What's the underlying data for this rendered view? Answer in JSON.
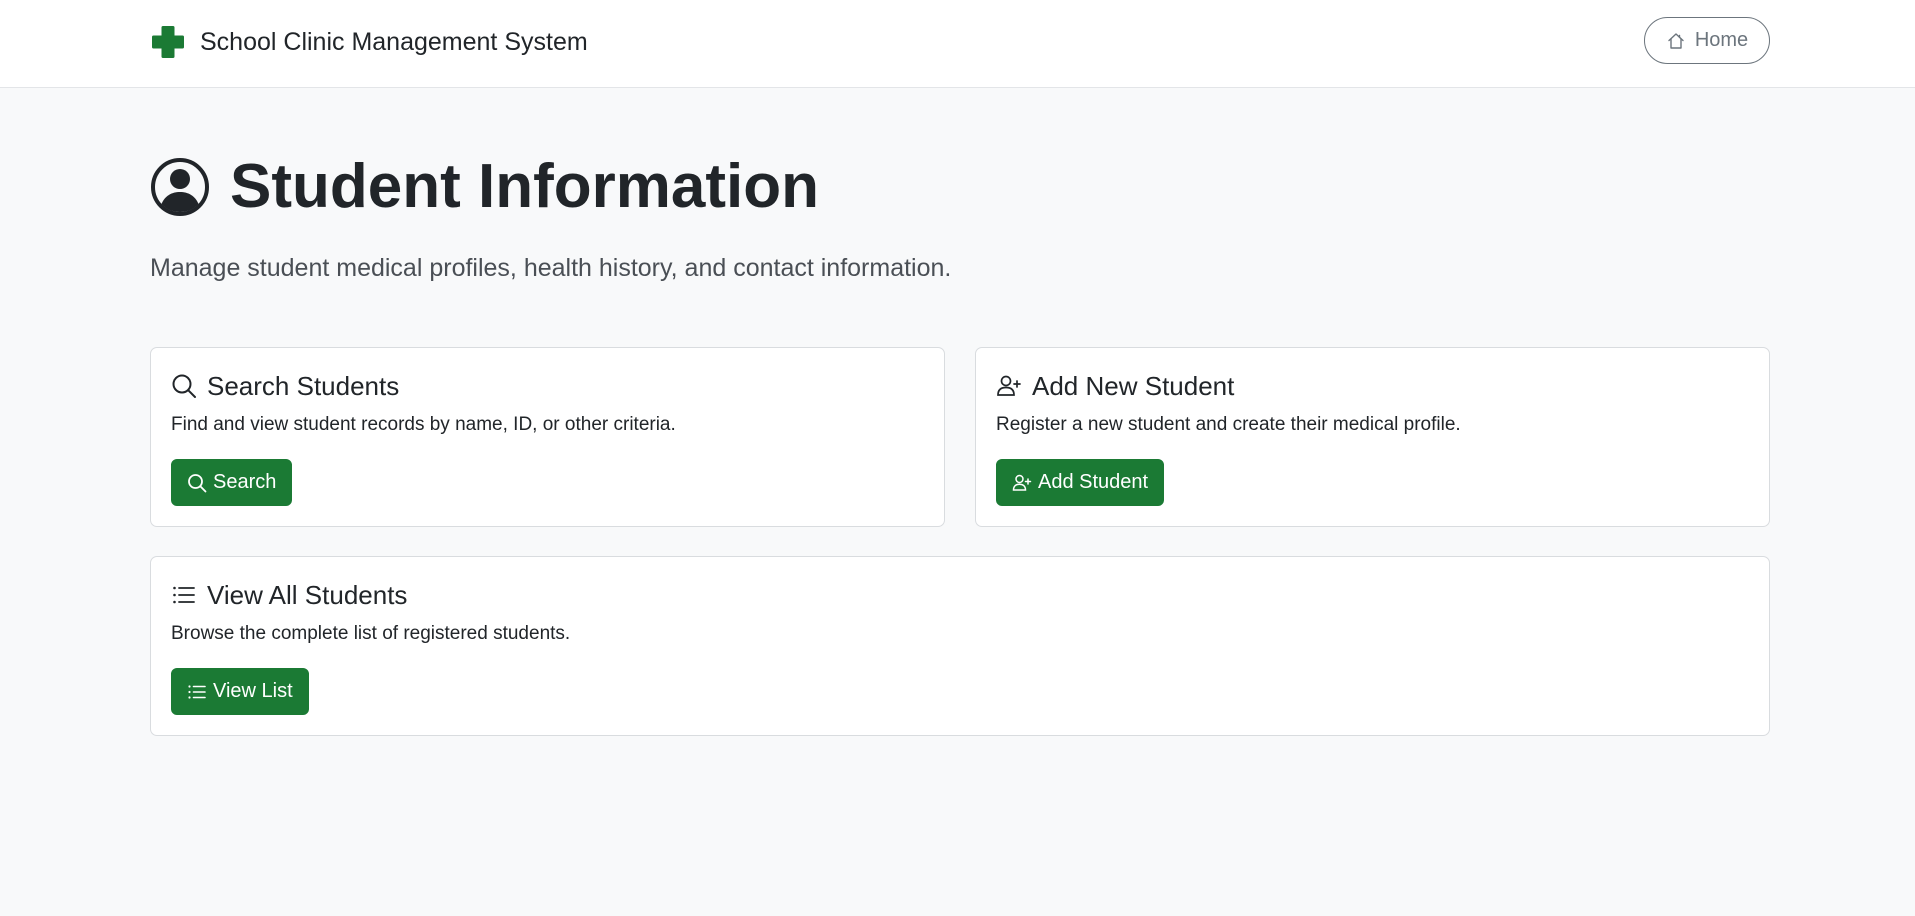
{
  "navbar": {
    "brand_title": "School Clinic Management System",
    "brand_icon": "plus-cross-icon",
    "brand_color": "#1b7a34",
    "home_button": {
      "label": "Home",
      "icon": "house-icon"
    }
  },
  "header": {
    "icon": "person-circle-icon",
    "title": "Student Information",
    "subtitle": "Manage student medical profiles, health history, and contact information."
  },
  "cards": [
    {
      "title": "Search Students",
      "icon": "search-icon",
      "text": "Find and view student records by name, ID, or other criteria.",
      "button_label": "Search"
    },
    {
      "title": "Add New Student",
      "icon": "person-add-icon",
      "text": "Register a new student and create their medical profile.",
      "button_label": "Add Student"
    },
    {
      "title": "View All Students",
      "icon": "list-icon",
      "text": "Browse the complete list of registered students.",
      "button_label": "View List"
    }
  ],
  "colors": {
    "accent": "#1b7a34",
    "background": "#f8f9fa",
    "text": "#212529",
    "muted": "#6c757d"
  }
}
